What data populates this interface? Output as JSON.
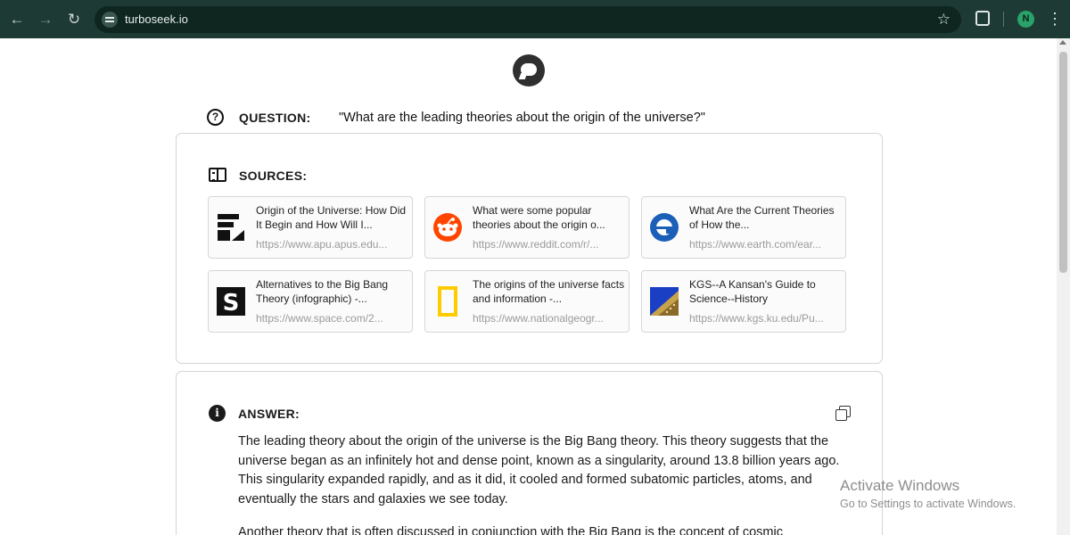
{
  "browser": {
    "url": "turboseek.io",
    "profile_initial": "N"
  },
  "question": {
    "label": "QUESTION:",
    "text": "\"What are the leading theories about the origin of the universe?\""
  },
  "sources": {
    "label": "SOURCES:",
    "items": [
      {
        "title": "Origin of the Universe: How Did It Begin and How Will I...",
        "url": "https://www.apu.apus.edu...",
        "icon": "apu-icon"
      },
      {
        "title": "What were some popular theories about the origin o...",
        "url": "https://www.reddit.com/r/...",
        "icon": "reddit-icon"
      },
      {
        "title": "What Are the Current Theories of How the...",
        "url": "https://www.earth.com/ear...",
        "icon": "earth-icon"
      },
      {
        "title": "Alternatives to the Big Bang Theory (infographic) -...",
        "url": "https://www.space.com/2...",
        "icon": "space-icon"
      },
      {
        "title": "The origins of the universe facts and information -...",
        "url": "https://www.nationalgeogr...",
        "icon": "natgeo-icon"
      },
      {
        "title": "KGS--A Kansan's Guide to Science--History",
        "url": "https://www.kgs.ku.edu/Pu...",
        "icon": "kgs-icon"
      }
    ]
  },
  "answer": {
    "label": "ANSWER:",
    "paragraph1": "The leading theory about the origin of the universe is the Big Bang theory. This theory suggests that the universe began as an infinitely hot and dense point, known as a singularity, around 13.8 billion years ago. This singularity expanded rapidly, and as it did, it cooled and formed subatomic particles, atoms, and eventually the stars and galaxies we see today.",
    "paragraph2": "Another theory that is often discussed in conjunction with the Big Bang is the concept of cosmic"
  },
  "watermark": {
    "title": "Activate Windows",
    "subtitle": "Go to Settings to activate Windows."
  },
  "colors": {
    "toolbar": "#1e3a34",
    "reddit": "#ff4500",
    "earth": "#1b5fb8",
    "natgeo": "#ffcc00"
  }
}
